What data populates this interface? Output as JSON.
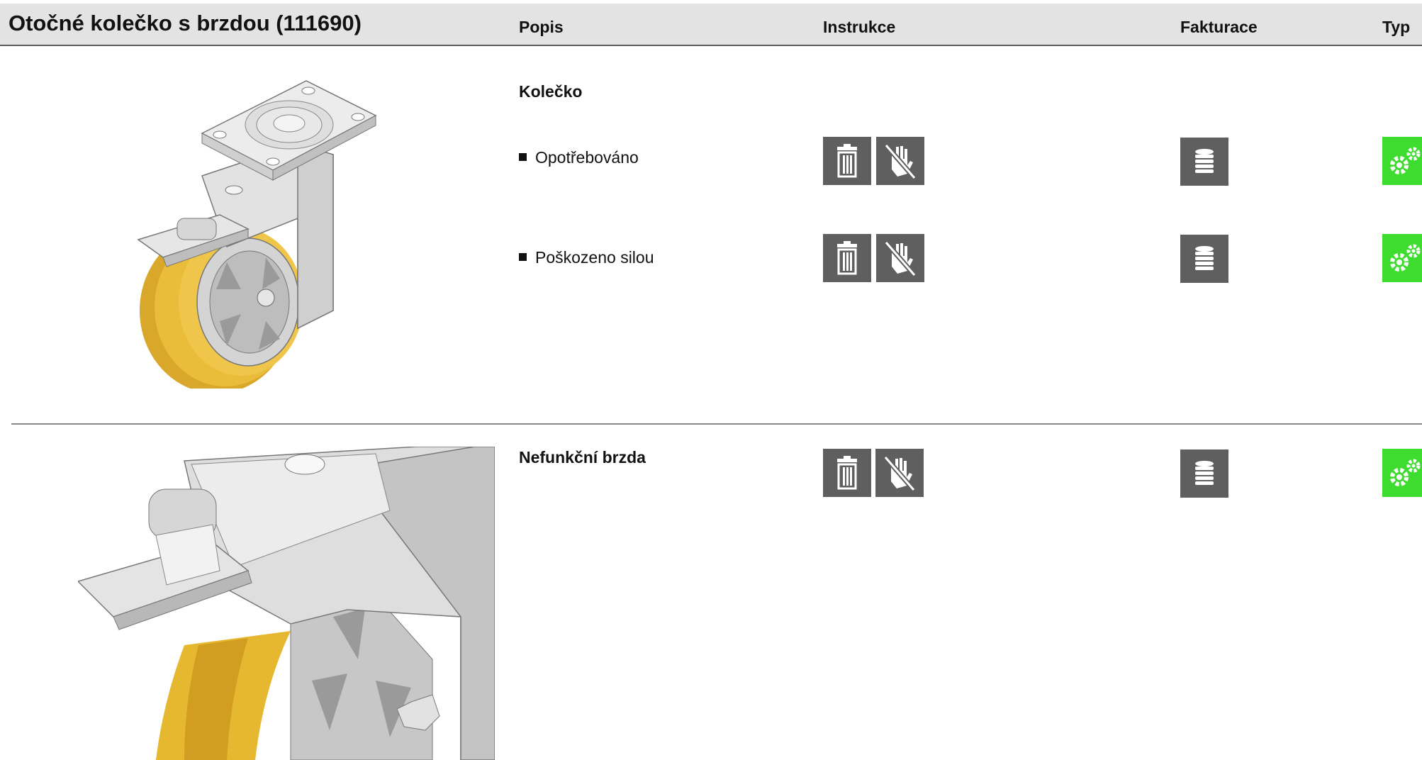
{
  "header": {
    "title": "Otočné kolečko s brzdou (111690)",
    "columns": {
      "popis": "Popis",
      "instrukce": "Instrukce",
      "fakturace": "Fakturace",
      "typ": "Typ"
    }
  },
  "sections": [
    {
      "image": "swivel-caster-with-brake",
      "heading": "Kolečko",
      "items": [
        {
          "label": "Opotřebováno",
          "instructions": [
            "trash-icon",
            "no-touch-icon"
          ],
          "billing": "coins-icon",
          "type": "gears-icon"
        },
        {
          "label": "Poškozeno silou",
          "instructions": [
            "trash-icon",
            "no-touch-icon"
          ],
          "billing": "coins-icon",
          "type": "gears-icon"
        }
      ]
    },
    {
      "image": "caster-brake-detail",
      "heading": "Nefunkční brzda",
      "instructions": [
        "trash-icon",
        "no-touch-icon"
      ],
      "billing": "coins-icon",
      "type": "gears-icon"
    }
  ],
  "colors": {
    "header_bg": "#e3e3e3",
    "icon_bg": "#5f5f5f",
    "type_bg": "#3ddc2f",
    "wheel_tread": "#e6b830"
  }
}
